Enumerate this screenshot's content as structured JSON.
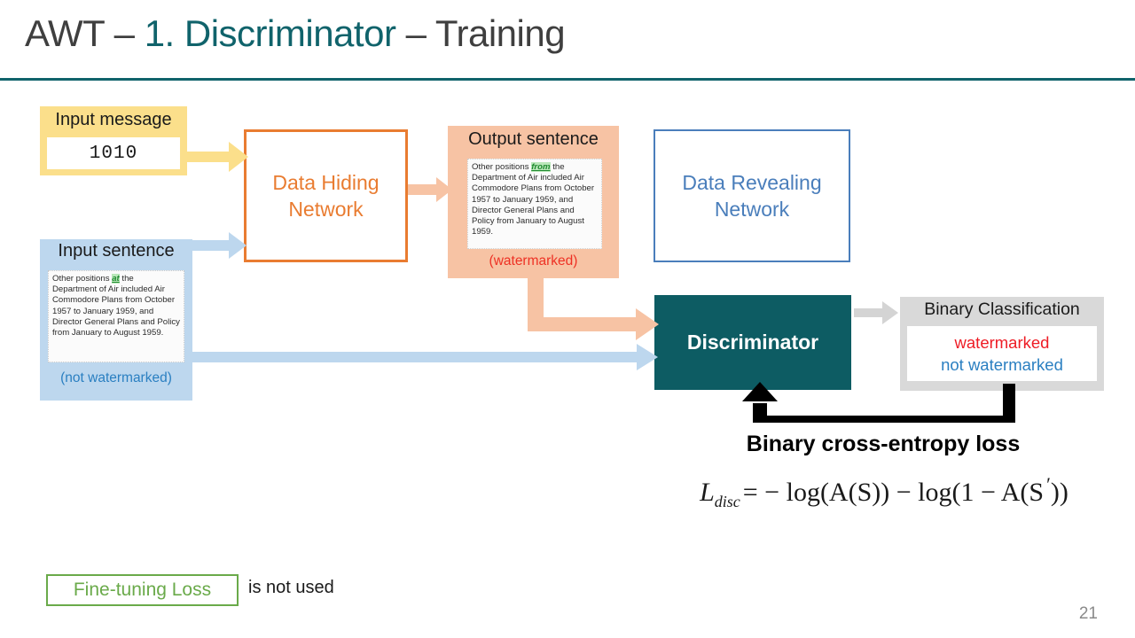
{
  "slide": {
    "title_prefix": "AWT – ",
    "title_accent": "1. Discriminator",
    "title_suffix": " – Training",
    "page_number": "21",
    "colors": {
      "accent_teal": "#10636b",
      "discriminator_fill": "#0d5c63",
      "input_message_fill": "#fbdf8b",
      "input_sentence_fill": "#bdd7ee",
      "output_sentence_fill": "#f7c3a4",
      "data_hiding_stroke": "#e97c31",
      "data_revealing_stroke": "#4a7ebb",
      "binary_classification_fill": "#d9d9d9",
      "watermarked_red": "#ee1c25",
      "not_watermarked_blue": "#2a7fc1",
      "finetune_green": "#6aaa4a",
      "token_green": "#1f8a2f"
    }
  },
  "input_message": {
    "label": "Input message",
    "value": "1010"
  },
  "input_sentence": {
    "label": "Input sentence",
    "text_before": "Other positions ",
    "token": "at",
    "text_after": " the Department of Air included Air Commodore Plans from October 1957 to January 1959, and Director General Plans and Policy from January to August 1959.",
    "caption": "(not watermarked)"
  },
  "data_hiding_network": {
    "label": "Data Hiding Network"
  },
  "output_sentence": {
    "label": "Output sentence",
    "text_before": "Other positions ",
    "token": "from",
    "text_after": " the Department of Air included Air Commodore Plans from October 1957 to January 1959, and Director General Plans and Policy from January to August 1959.",
    "caption": "(watermarked)"
  },
  "data_revealing_network": {
    "label": "Data Revealing Network"
  },
  "discriminator": {
    "label": "Discriminator"
  },
  "binary_classification": {
    "label": "Binary Classification",
    "option_watermarked": "watermarked",
    "option_not_watermarked": "not watermarked"
  },
  "loss": {
    "title": "Binary cross-entropy loss",
    "formula_plain": "L_disc = − log(A(S)) − log(1 − A(S'))",
    "formula_lhs": "L",
    "formula_sub": "disc",
    "formula_rhs": "= − log(A(S)) − log(1 − A(S",
    "formula_tail": "))"
  },
  "footnote": {
    "boxed_label": "Fine-tuning Loss",
    "note": "is not used"
  }
}
